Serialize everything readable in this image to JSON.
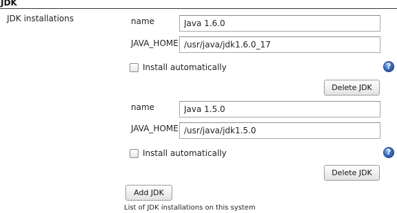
{
  "section": {
    "title": "JDK"
  },
  "row_label": "JDK installations",
  "jdks": [
    {
      "name_label": "name",
      "name_value": "Java 1.6.0",
      "home_label": "JAVA_HOME",
      "home_value": "/usr/java/jdk1.6.0_17",
      "install_auto_label": "Install automatically",
      "install_auto_checked": false,
      "delete_label": "Delete JDK",
      "help_icon": "help-question-icon"
    },
    {
      "name_label": "name",
      "name_value": "Java 1.5.0",
      "home_label": "JAVA_HOME",
      "home_value": "/usr/java/jdk1.5.0",
      "install_auto_label": "Install automatically",
      "install_auto_checked": false,
      "delete_label": "Delete JDK",
      "help_icon": "help-question-icon"
    }
  ],
  "add_label": "Add JDK",
  "description": "List of JDK installations on this system",
  "colors": {
    "help_icon": "#3d6fc0",
    "header_rule": "#333333"
  }
}
